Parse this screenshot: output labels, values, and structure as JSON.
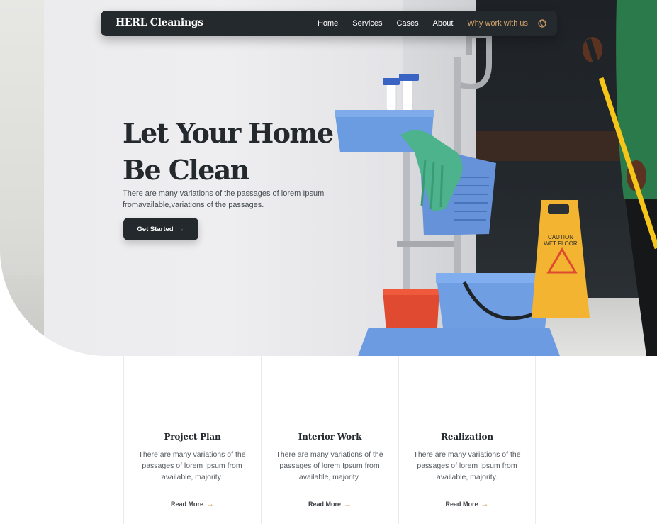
{
  "nav": {
    "brand": "HERL Cleanings",
    "items": [
      {
        "label": "Home"
      },
      {
        "label": "Services"
      },
      {
        "label": "Cases"
      },
      {
        "label": "About"
      },
      {
        "label": "Why work with us"
      }
    ],
    "globe_icon": "globe-icon"
  },
  "hero": {
    "title_line1": "Let Your Home",
    "title_line2": "Be Clean",
    "desc_line1": "There are many variations of the passages of lorem Ipsum",
    "desc_line2": "fromavailable,variations of the passages.",
    "cta_label": "Get Started",
    "cta_icon": "arrow-right-icon",
    "sign_text_line1": "CAUTION",
    "sign_text_line2": "WET FLOOR"
  },
  "cards": [
    {
      "title": "Project Plan",
      "desc_line1": "There are many variations of the",
      "desc_line2": "passages of lorem Ipsum from",
      "desc_line3": "available, majority.",
      "link": "Read More"
    },
    {
      "title": "Interior Work",
      "desc_line1": "There are many variations of the",
      "desc_line2": "passages of lorem Ipsum from",
      "desc_line3": "available, majority.",
      "link": "Read More"
    },
    {
      "title": "Realization",
      "desc_line1": "There are many variations of the",
      "desc_line2": "passages of lorem Ipsum from",
      "desc_line3": "available, majority.",
      "link": "Read More"
    }
  ],
  "colors": {
    "dark": "#24292e",
    "accent": "#d6a36a",
    "cart_blue": "#6b9be0",
    "sign_yellow": "#f2b431",
    "mop_yellow": "#f5c518"
  }
}
